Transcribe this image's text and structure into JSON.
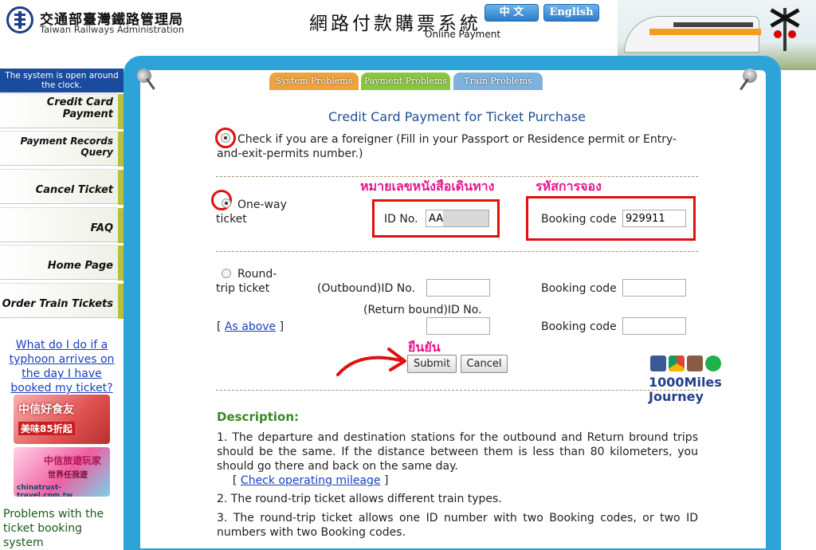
{
  "header": {
    "org_name_zh": "交通部臺灣鐵路管理局",
    "org_name_en": "Taiwan Railways Administration",
    "system_name_zh": "網路付款購票系統",
    "system_name_en": "Online Payment",
    "lang_zh": "中 文",
    "lang_en": "English"
  },
  "tabs": [
    "System Problems",
    "Payment Problems",
    "Train Problems"
  ],
  "sidebar": {
    "notice": "The system is open around the clock.",
    "items": [
      {
        "label": "Credit Card Payment"
      },
      {
        "label": "Payment Records Query"
      },
      {
        "label": "Cancel Ticket"
      },
      {
        "label": "FAQ"
      },
      {
        "label": "Home Page"
      },
      {
        "label": "Order Train Tickets"
      }
    ],
    "typhoon_link": "What do I do if a typhoon arrives on the day I have booked my ticket?",
    "ad1": {
      "title": "中信好食友",
      "sub": "美味85折起"
    },
    "ad2": {
      "title": "中信旅遊玩家",
      "sub": "世界任我遊",
      "url": "chinatrust-travel.com.tw"
    },
    "problems_text": "Problems with the ticket booking system"
  },
  "form": {
    "title": "Credit Card Payment for Ticket Purchase",
    "foreigner_label": "Check if you are a foreigner (Fill in your Passport or Residence permit or Entry-and-exit-permits number.)",
    "oneway_label_1": "One-way",
    "oneway_label_2": "ticket",
    "id_label": "ID No.",
    "id_value": "AA",
    "booking_label": "Booking code",
    "booking_value": "929911",
    "annot_passport": "หมายเลขหนังสือเดินทาง",
    "annot_booking": "รหัสการจอง",
    "roundtrip_label_1": "Round-",
    "roundtrip_label_2": "trip ticket",
    "outbound_id_label": "(Outbound)ID No.",
    "return_id_label": "(Return bound)ID No.",
    "as_above": "As above",
    "annot_confirm": "ยืนยัน",
    "submit": "Submit",
    "cancel": "Cancel"
  },
  "description": {
    "heading": "Description:",
    "items": [
      "1. The departure and destination stations for the outbound and Return bround trips should be the same. If the distance between them is less than 80 kilometers, you should go there and back on the same day.",
      "2. The round-trip ticket allows different train types.",
      "3. The round-trip ticket allows one ID number with two Booking codes, or two ID numbers with two Booking codes."
    ],
    "mileage_link": "Check operating mileage"
  },
  "watermark": {
    "line1": "1000Miles",
    "line2": "Journey"
  },
  "colors": {
    "accent_blue": "#2da3d8",
    "sidebar_blue": "#1a4b9c",
    "annotation_red": "#e01010",
    "annotation_pink": "#e6168c",
    "description_green": "#3a8a1e"
  }
}
